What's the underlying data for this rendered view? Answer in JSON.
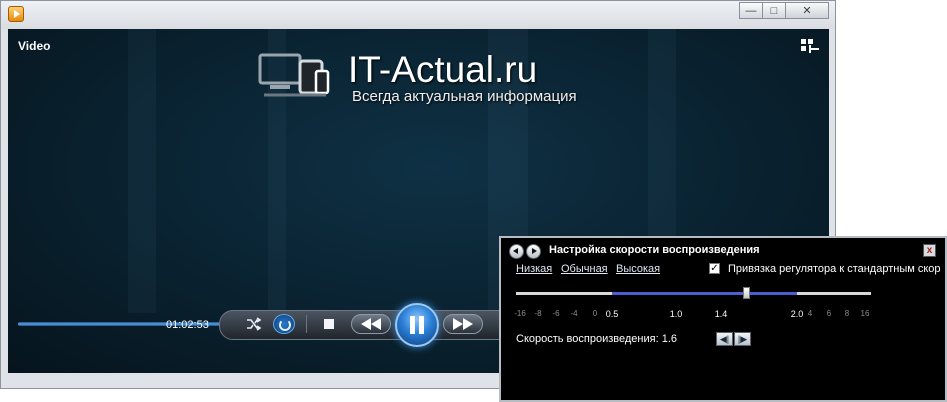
{
  "player": {
    "video_label": "Video",
    "watermark": {
      "name": "IT-Actual.ru",
      "tagline": "Всегда актуальная информация"
    },
    "playback": {
      "elapsed_time": "01:02:53",
      "position_fraction": 0.62
    },
    "window_buttons": {
      "minimize": "—",
      "maximize": "□",
      "close": "✕"
    },
    "icons": [
      "app-icon",
      "layout-switch-icon",
      "shuffle-icon",
      "repeat-icon",
      "stop-icon",
      "previous-icon",
      "pause-icon",
      "next-icon"
    ]
  },
  "speed_dialog": {
    "title": "Настройка скорости воспроизведения",
    "close_glyph": "x",
    "presets": [
      "Низкая",
      "Обычная",
      "Высокая"
    ],
    "snap_checkbox": {
      "label": "Привязка регулятора к стандартным скор",
      "checked": true,
      "glyph": "✓"
    },
    "slider": {
      "ticks": [
        "-16",
        "-8",
        "-6",
        "-4",
        "0",
        "0.5",
        "1.0",
        "1.4",
        "2.0",
        "4",
        "6",
        "8",
        "16"
      ],
      "fill_from": "0.5",
      "fill_to": "2.0",
      "value": "1.6"
    },
    "speed_label": "Скорость воспроизведения: 1.6",
    "step_buttons": [
      "◀|",
      "|▶"
    ],
    "colors": {
      "slider_fill": "#4b5fd0",
      "background": "#000000"
    }
  }
}
